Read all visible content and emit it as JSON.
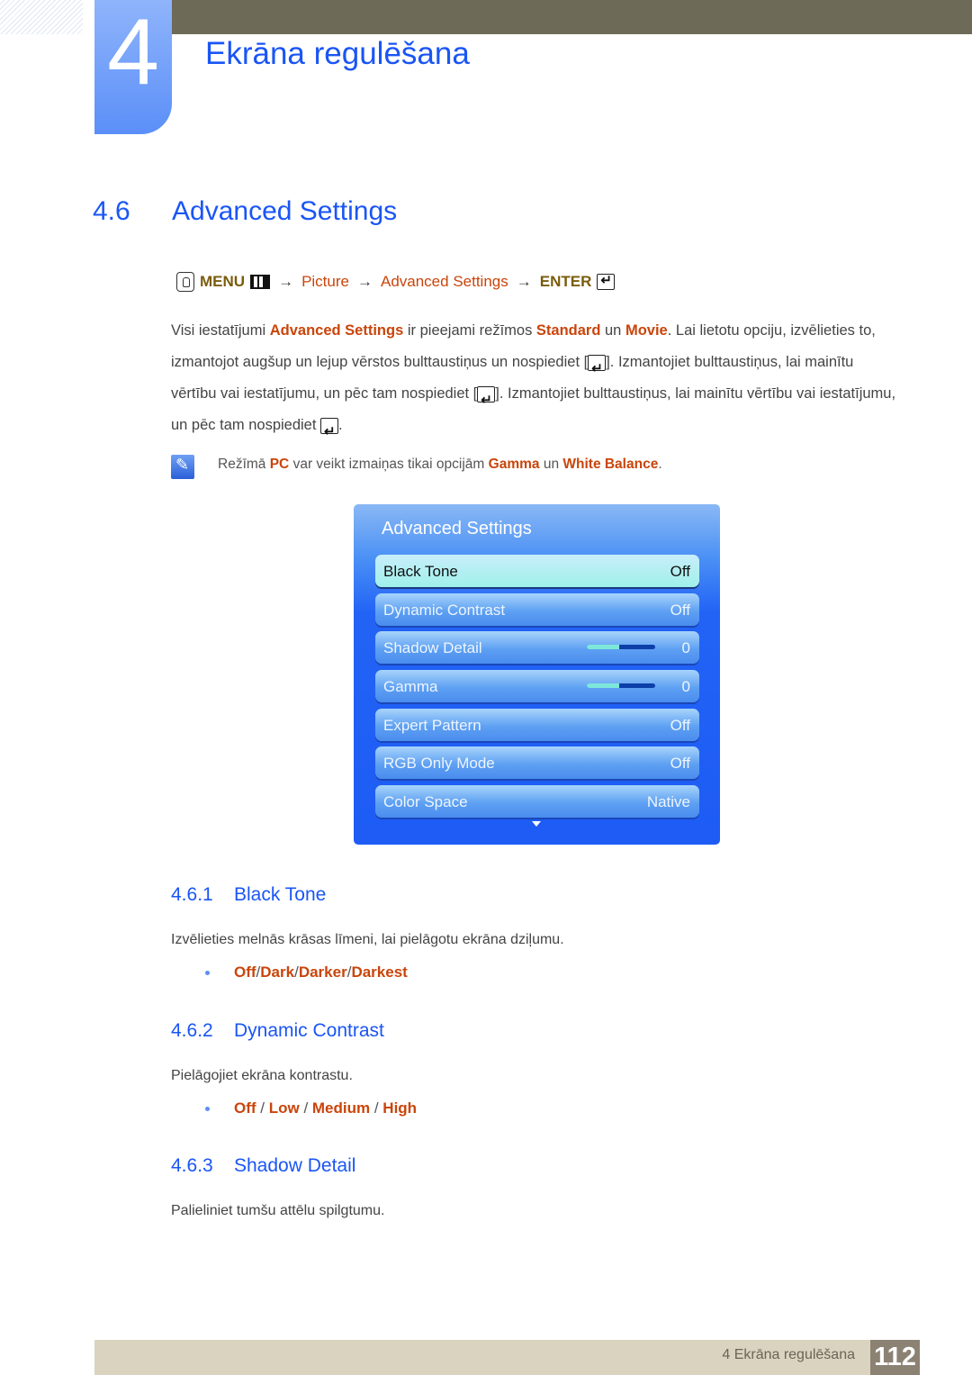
{
  "header": {
    "chapter_number": "4",
    "chapter_title": "Ekrāna regulēšana"
  },
  "section": {
    "number": "4.6",
    "title": "Advanced Settings"
  },
  "menu_path": {
    "menu_label": "MENU",
    "arrow": "→",
    "picture": "Picture",
    "advanced_settings": "Advanced Settings",
    "enter_label": "ENTER",
    "icons": [
      "remote-hand-icon",
      "menu-grid-icon",
      "enter-icon"
    ]
  },
  "intro": {
    "p1": "Visi iestatījumi ",
    "h1": "Advanced Settings",
    "p2": " ir pieejami režīmos ",
    "h2": "Standard",
    "p3": " un ",
    "h3": "Movie",
    "p4": ". Lai lietotu opciju, izvēlieties to, izmantojot augšup un lejup vērstos bulttaustiņus un nospiediet [",
    "p5": "]. Izmantojiet bulttaustiņus, lai mainītu vērtību vai iestatījumu, un pēc tam nospiediet [",
    "p6": "]. Izmantojiet bulttaustiņus, lai mainītu vērtību vai iestatījumu, un pēc tam nospiediet ",
    "p7": "."
  },
  "note": {
    "icon": "note-pencil-icon",
    "t1": "Režīmā ",
    "h1": "PC",
    "t2": " var veikt izmaiņas tikai opcijām ",
    "h2": "Gamma",
    "t3": " un ",
    "h3": "White Balance",
    "t4": "."
  },
  "osd": {
    "title": "Advanced Settings",
    "items": [
      {
        "label": "Black Tone",
        "value": "Off",
        "selected": true
      },
      {
        "label": "Dynamic Contrast",
        "value": "Off"
      },
      {
        "label": "Shadow Detail",
        "value": "0",
        "slider_fraction": 0.47
      },
      {
        "label": "Gamma",
        "value": "0",
        "slider_fraction": 0.47
      },
      {
        "label": "Expert Pattern",
        "value": "Off"
      },
      {
        "label": "RGB Only Mode",
        "value": "Off"
      },
      {
        "label": "Color Space",
        "value": "Native"
      }
    ],
    "more_icon": "scroll-down-arrow-icon"
  },
  "subsections": [
    {
      "number": "4.6.1",
      "title": "Black Tone",
      "text": "Izvēlieties melnās krāsas līmeni, lai pielāgotu ekrāna dziļumu.",
      "options": [
        "Off",
        "Dark",
        "Darker",
        "Darkest"
      ],
      "separator": "/"
    },
    {
      "number": "4.6.2",
      "title": "Dynamic Contrast",
      "text": "Pielāgojiet ekrāna kontrastu.",
      "options": [
        "Off",
        "Low",
        "Medium",
        "High"
      ],
      "separator": " / "
    },
    {
      "number": "4.6.3",
      "title": "Shadow Detail",
      "text": "Palieliniet tumšu attēlu spilgtumu."
    }
  ],
  "footer": {
    "chapter_label": "4 Ekrāna regulēšana",
    "page_number": "112"
  }
}
